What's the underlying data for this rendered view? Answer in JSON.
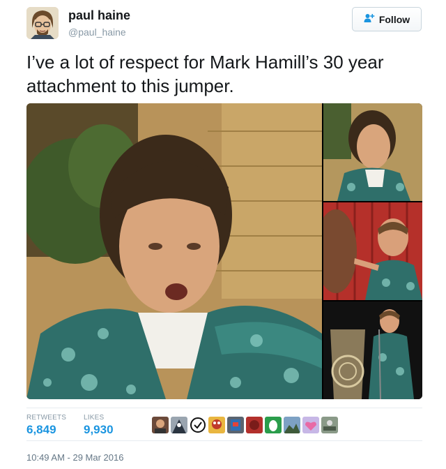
{
  "user": {
    "name": "paul haine",
    "handle": "@paul_haine"
  },
  "follow": {
    "label": "Follow",
    "icon": "add-user-icon"
  },
  "tweet": {
    "text": "I’ve a lot of respect for Mark Hamill’s 30 year attachment to this jumper."
  },
  "stats": {
    "retweets_label": "RETWEETS",
    "retweets": "6,849",
    "likes_label": "LIKES",
    "likes": "9,930"
  },
  "timestamp": "10:49 AM - 29 Mar 2016",
  "colors": {
    "link": "#1b95e0",
    "muted": "#8899a6",
    "text": "#14171a"
  }
}
